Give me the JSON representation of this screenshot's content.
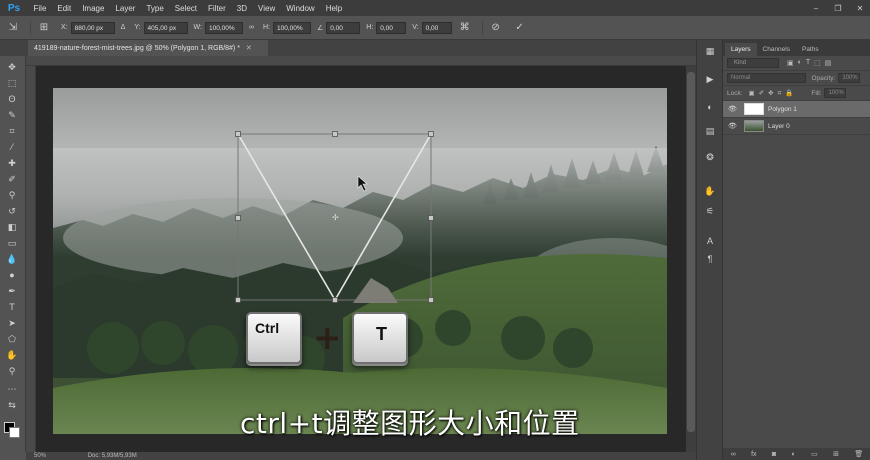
{
  "app": {
    "logo": "Ps",
    "name": "Adobe Photoshop"
  },
  "menu": [
    "File",
    "Edit",
    "Image",
    "Layer",
    "Type",
    "Select",
    "Filter",
    "3D",
    "View",
    "Window",
    "Help"
  ],
  "window_controls": [
    "–",
    "❐",
    "✕"
  ],
  "options": {
    "x_label": "X:",
    "x_value": "880,00 px",
    "y_label": "Y:",
    "y_value": "405,00 px",
    "w_label": "W:",
    "w_value": "100,00%",
    "h_label": "H:",
    "h_value": "100,00%",
    "angle_value": "0,00",
    "hskew_label": "H:",
    "hskew_value": "0,00",
    "vskew_label": "V:",
    "vskew_value": "0,00"
  },
  "document": {
    "tab_title": "419189-nature-forest-mist-trees.jpg @ 50% (Polygon 1, RGB/8#) *",
    "zoom": "50%",
    "doc_info": "Doc: 5,93M/5,93M"
  },
  "layers_panel": {
    "tabs": [
      "Layers",
      "Channels",
      "Paths"
    ],
    "kind_placeholder": "Kind",
    "blend_mode": "Normal",
    "opacity_label": "Opacity:",
    "opacity_value": "100%",
    "lock_label": "Lock:",
    "fill_label": "Fill:",
    "fill_value": "100%",
    "layers": [
      {
        "name": "Polygon 1",
        "selected": true
      },
      {
        "name": "Layer 0",
        "selected": false
      }
    ]
  },
  "overlay": {
    "key1": "Ctrl",
    "plus": "+",
    "key2": "T",
    "subtitle": "ctrl+t调整图形大小和位置"
  },
  "colors": {
    "accent": "#2fa3f6",
    "chrome": "#535353",
    "menubar": "#3c3c3c"
  }
}
